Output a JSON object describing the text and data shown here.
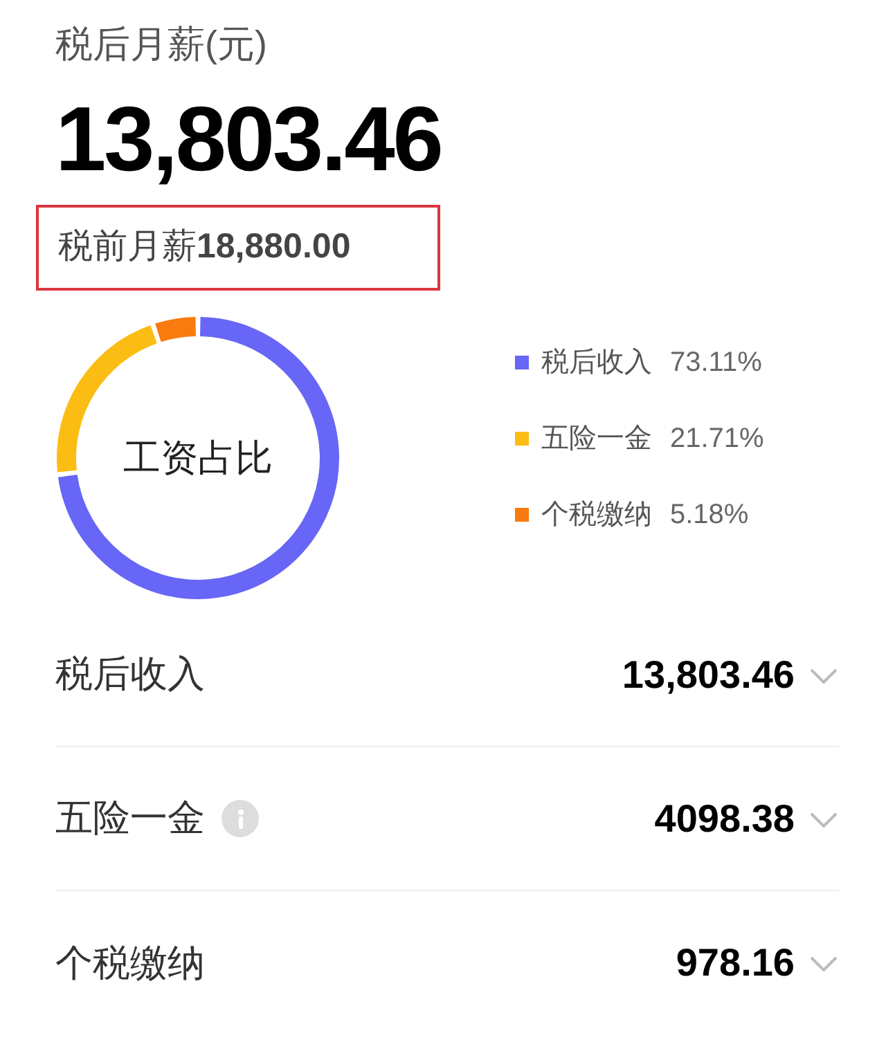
{
  "header": {
    "title": "税后月薪(元)",
    "amount": "13,803.46",
    "pretax": "税前月薪**18,880.00**",
    "pretax_highlighted": true
  },
  "chart": {
    "chart_data": {
      "type": "donut",
      "title": "工资占比",
      "categories": [
        "税后收入",
        "五险一金",
        "个税缴纳"
      ],
      "values": [
        73.11,
        21.71,
        5.18
      ]
    }
  },
  "legend": [
    {
      "percent": "73.11%",
      "color": "#6766f6"
    },
    {
      "percent": "21.71%",
      "color": "#fbbd14"
    },
    {
      "percent": "5.18%",
      "color": "#f97a0e"
    }
  ],
  "rows": [
    {
      "label": "税后收入",
      "value": "13,803.46",
      "info": false,
      "expanded": false
    },
    {
      "label": "五险一金",
      "value": "4098.38",
      "info": true,
      "expanded": false
    },
    {
      "label": "个税缴纳",
      "value": "978.16",
      "info": false,
      "expanded": false
    }
  ]
}
